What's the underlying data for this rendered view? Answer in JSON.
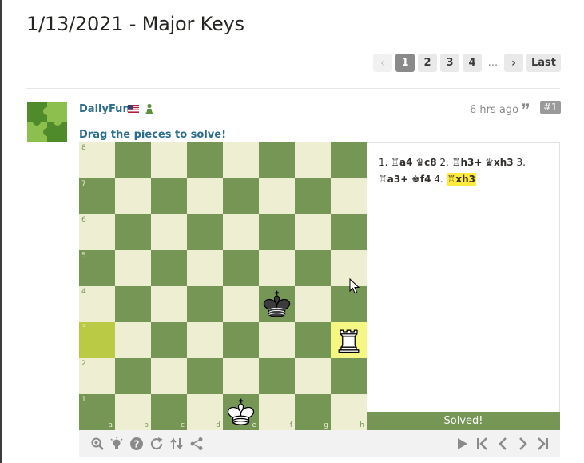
{
  "page": {
    "title": "1/13/2021 - Major Keys"
  },
  "pagination": {
    "prev_icon": "chevron-left-icon",
    "pages": [
      "1",
      "2",
      "3",
      "4"
    ],
    "active_page": "1",
    "ellipsis": "...",
    "next_icon": "chevron-right-icon",
    "last_label": "Last"
  },
  "post": {
    "author": "DailyFun",
    "flag_icon": "us-flag-icon",
    "badge_icon": "pawn-icon",
    "time": "6 hrs ago",
    "quote_icon": "quote-icon",
    "post_number": "#1",
    "instruction": "Drag the pieces to solve!"
  },
  "board": {
    "ranks": [
      "8",
      "7",
      "6",
      "5",
      "4",
      "3",
      "2",
      "1"
    ],
    "files": [
      "a",
      "b",
      "c",
      "d",
      "e",
      "f",
      "g",
      "h"
    ],
    "pieces": [
      {
        "square": "f4",
        "piece": "black-king"
      },
      {
        "square": "h3",
        "piece": "white-rook"
      },
      {
        "square": "e1",
        "piece": "white-king"
      }
    ],
    "highlight_squares": [
      "a3",
      "h3"
    ],
    "colors": {
      "light": "#eeeed2",
      "dark": "#769656",
      "last_move_to": "#f6f682",
      "last_move_from": "#baca44"
    }
  },
  "moves": {
    "m1n": "1.",
    "m1w": "a4",
    "m1b": "c8",
    "m2n": "2.",
    "m2w": "h3+",
    "m2b": "xh3",
    "m3n": "3.",
    "m3w": "a3+",
    "m3b": "f4",
    "m4n": "4.",
    "m4w": "xh3",
    "current_move": "xh3"
  },
  "status": {
    "solved_label": "Solved!"
  },
  "toolbar": {
    "left_icons": [
      "analysis-icon",
      "hint-icon",
      "help-icon",
      "retry-icon",
      "flip-board-icon",
      "share-icon"
    ],
    "right_icons": [
      "play-icon",
      "first-move-icon",
      "previous-move-icon",
      "next-move-icon",
      "last-move-icon"
    ]
  }
}
